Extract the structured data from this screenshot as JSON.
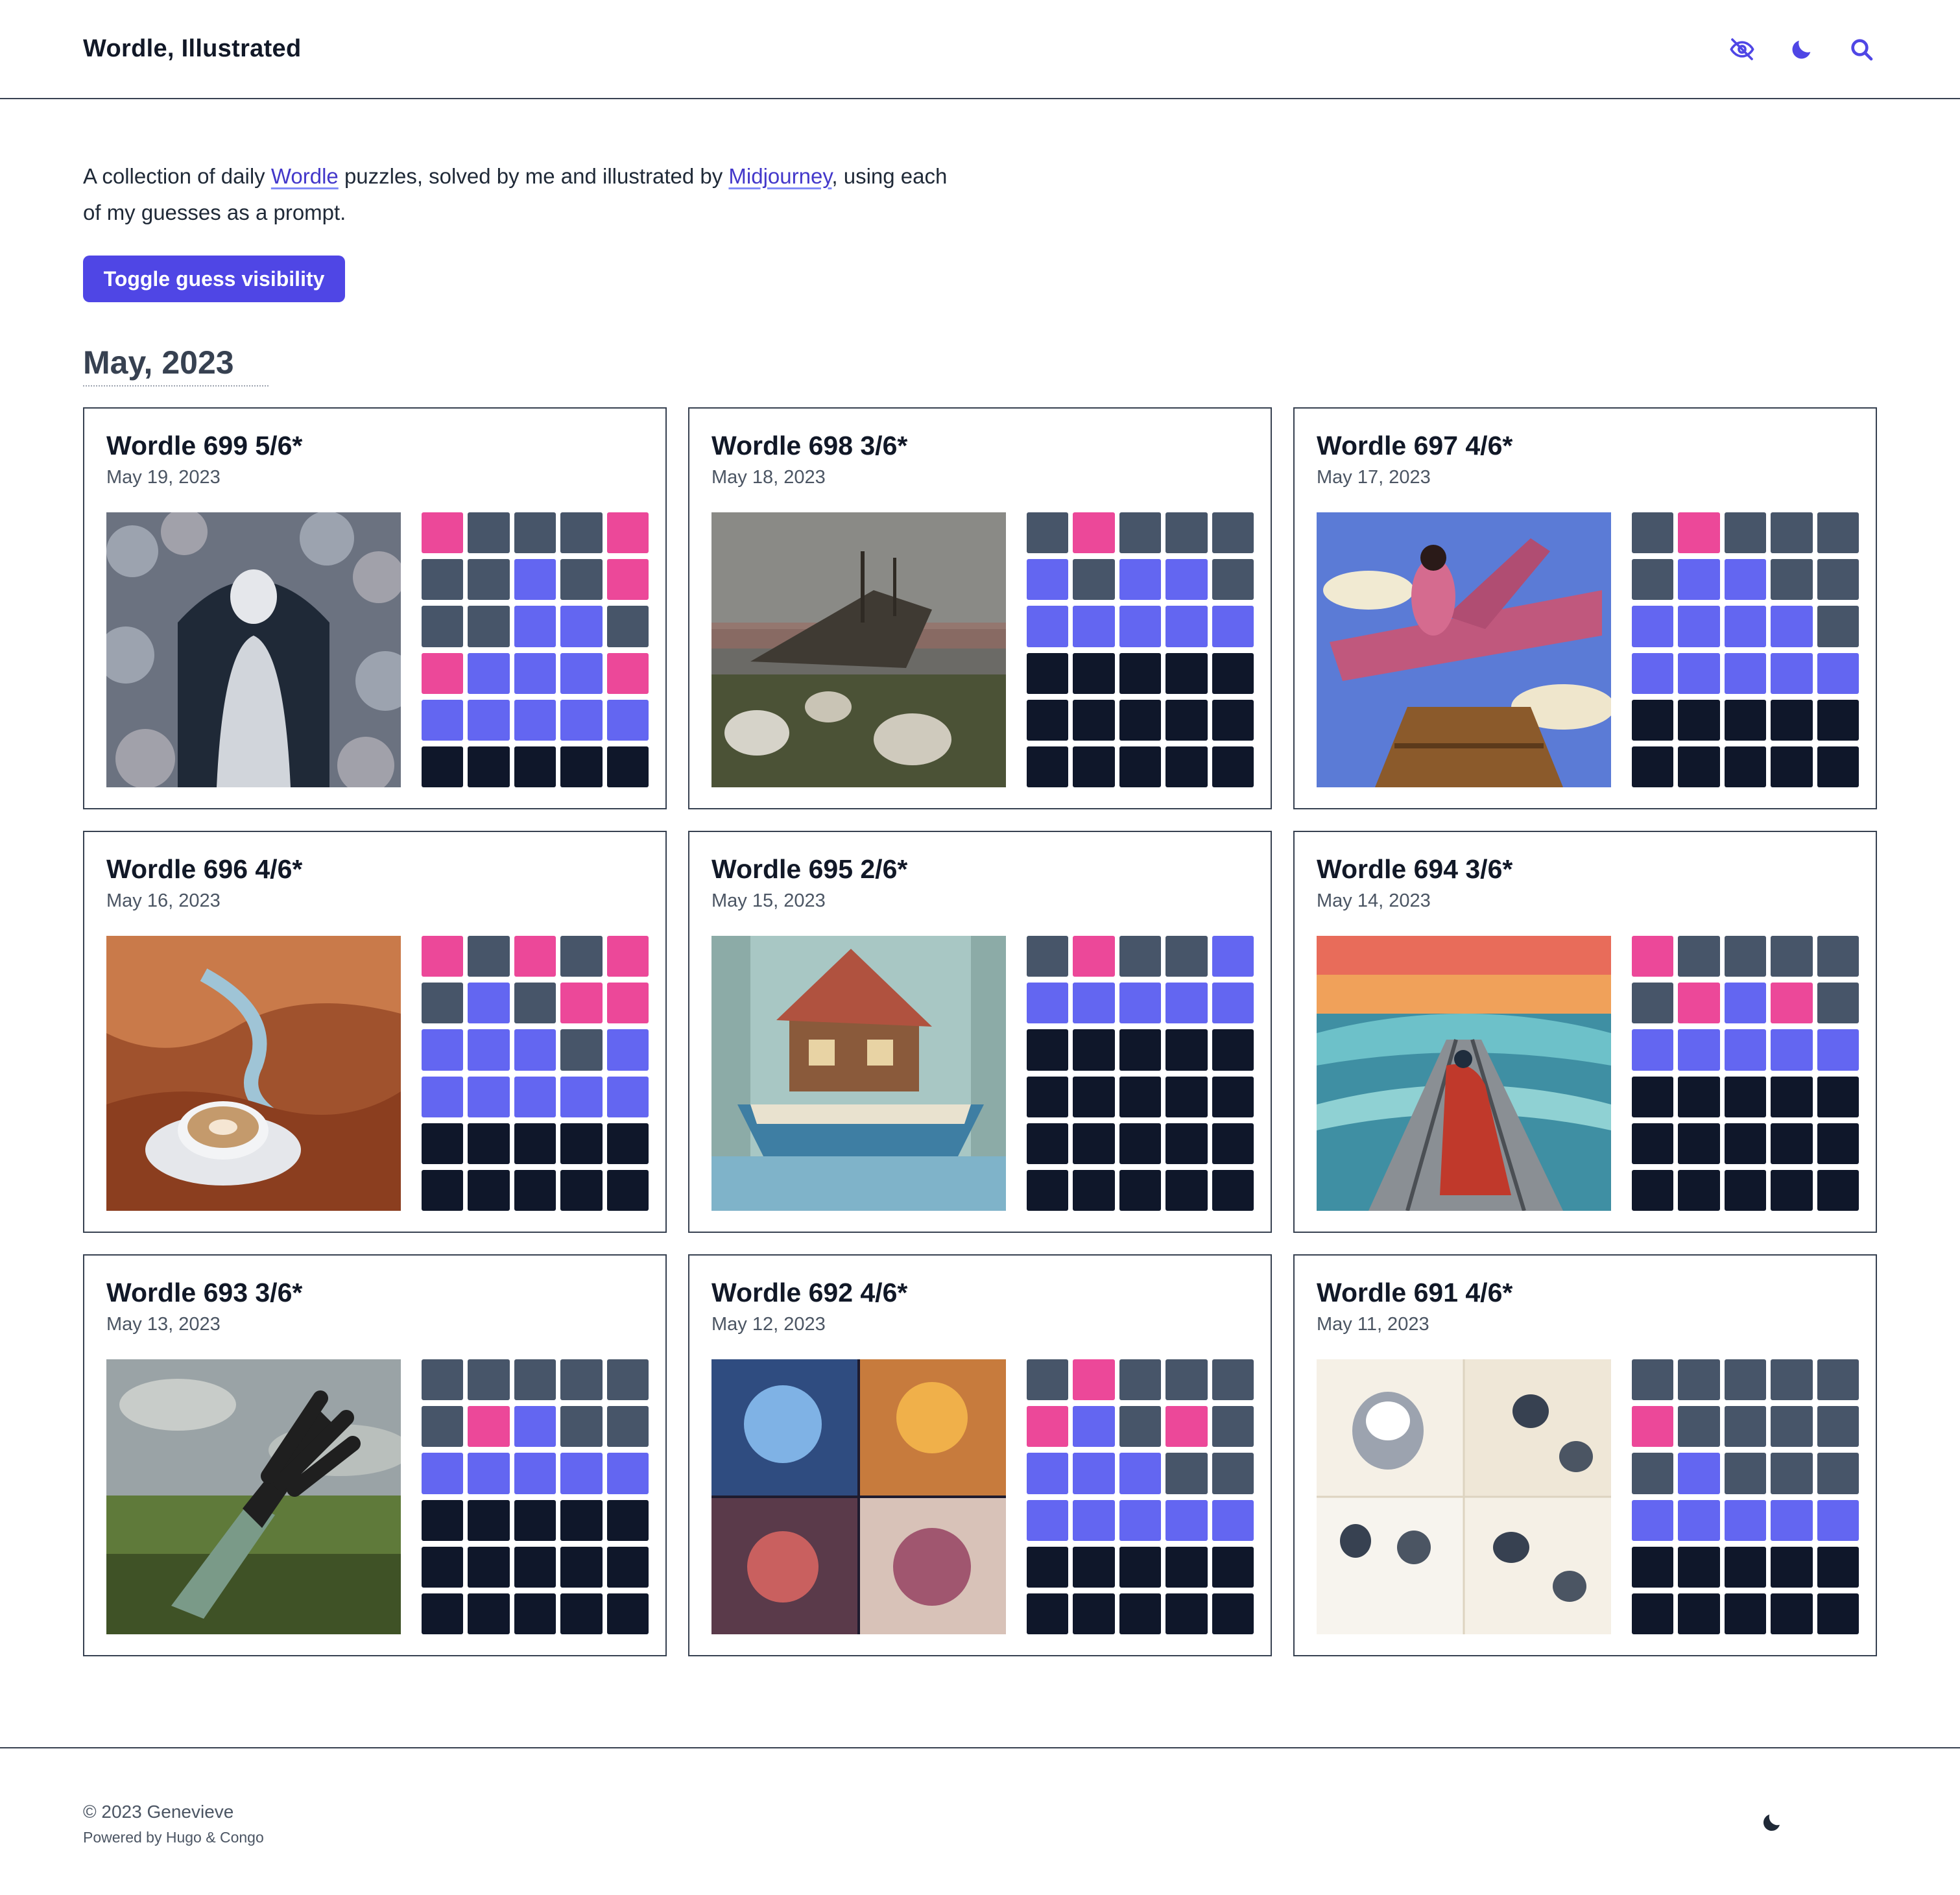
{
  "site": {
    "title": "Wordle, Illustrated"
  },
  "header_icons": [
    "eye-slash-icon",
    "moon-icon",
    "search-icon"
  ],
  "intro": {
    "text_1": "A collection of daily ",
    "link_wordle": "Wordle",
    "text_2": " puzzles, solved by me and illustrated by ",
    "link_midjourney": "Midjourney",
    "text_3": ", using each of my guesses as a prompt."
  },
  "toggle_button": "Toggle guess visibility",
  "month_heading": "May, 2023",
  "colors": {
    "accent": "#4f46e5",
    "tile_absent": "#475569",
    "tile_present": "#ec4899",
    "tile_correct": "#6366f1",
    "tile_empty": "#0f172a"
  },
  "cards": [
    {
      "title": "Wordle 699 5/6*",
      "date": "May 19, 2023",
      "image": "ghostly-girl-angels-illustration",
      "grid": [
        "pgggp",
        "ggbgp",
        "ggbbg",
        "pbbbp",
        "bbbbb",
        "eeeee"
      ]
    },
    {
      "title": "Wordle 698 3/6*",
      "date": "May 18, 2023",
      "image": "shipwreck-sheep-illustration",
      "grid": [
        "gpggg",
        "bgbbg",
        "bbbbb",
        "eeeee",
        "eeeee",
        "eeeee"
      ]
    },
    {
      "title": "Wordle 697 4/6*",
      "date": "May 17, 2023",
      "image": "pink-airplane-figure-illustration",
      "grid": [
        "gpggg",
        "gbbgg",
        "bbbbg",
        "bbbbb",
        "eeeee",
        "eeeee"
      ]
    },
    {
      "title": "Wordle 696 4/6*",
      "date": "May 16, 2023",
      "image": "canyon-coffee-cup-illustration",
      "grid": [
        "pgpgp",
        "gbgpp",
        "bbbgb",
        "bbbbb",
        "eeeee",
        "eeeee"
      ]
    },
    {
      "title": "Wordle 695 2/6*",
      "date": "May 15, 2023",
      "image": "boat-house-illustration",
      "grid": [
        "gpggb",
        "bbbbb",
        "eeeee",
        "eeeee",
        "eeeee",
        "eeeee"
      ]
    },
    {
      "title": "Wordle 694 3/6*",
      "date": "May 14, 2023",
      "image": "railway-wanderer-illustration",
      "grid": [
        "pgggg",
        "gpbpg",
        "bbbbb",
        "eeeee",
        "eeeee",
        "eeeee"
      ]
    },
    {
      "title": "Wordle 693 3/6*",
      "date": "May 13, 2023",
      "image": "glove-field-illustration",
      "grid": [
        "ggggg",
        "gpbgg",
        "bbbbb",
        "eeeee",
        "eeeee",
        "eeeee"
      ]
    },
    {
      "title": "Wordle 692 4/6*",
      "date": "May 12, 2023",
      "image": "comic-collage-illustration",
      "grid": [
        "gpggg",
        "pbgpg",
        "bbbgg",
        "bbbbb",
        "eeeee",
        "eeeee"
      ]
    },
    {
      "title": "Wordle 691 4/6*",
      "date": "May 11, 2023",
      "image": "husky-sketches-illustration",
      "grid": [
        "ggggg",
        "pgggg",
        "gbggg",
        "bbbbb",
        "eeeee",
        "eeeee"
      ]
    }
  ],
  "footer": {
    "copyright": "© 2023 Genevieve",
    "powered_by": "Powered by Hugo & Congo",
    "appearance_icon": "moon-icon"
  }
}
